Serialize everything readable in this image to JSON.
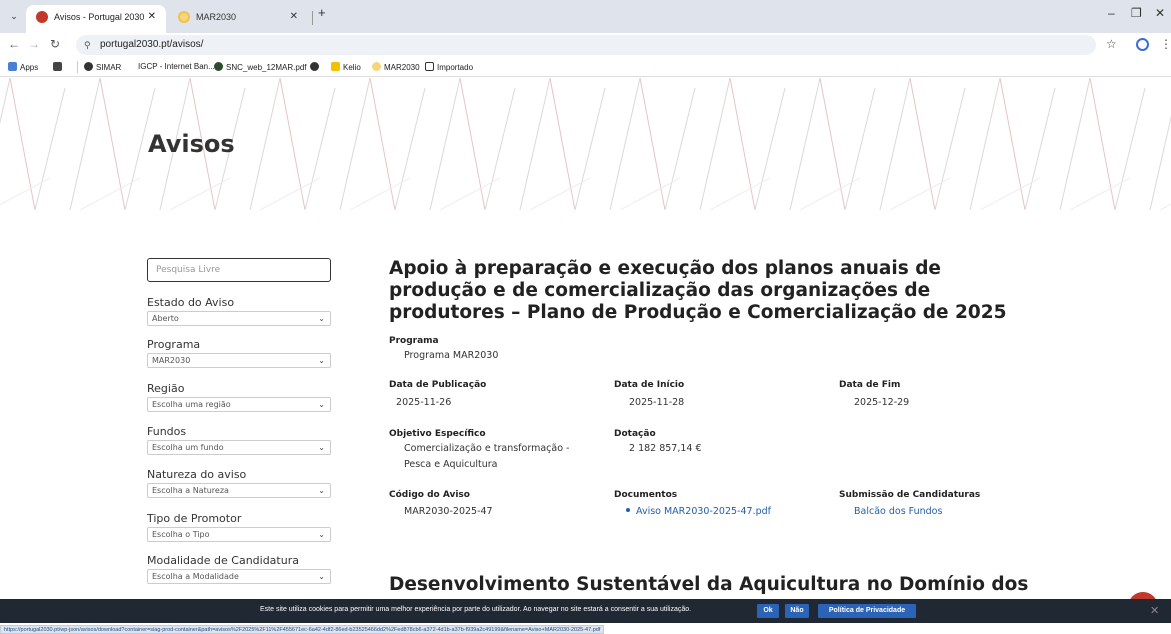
{
  "browser": {
    "tabs": [
      {
        "title": "Avisos - Portugal 2030",
        "active": true
      },
      {
        "title": "MAR2030",
        "active": false
      }
    ],
    "new_tab": "+",
    "url": "portugal2030.pt/avisos/",
    "bookmarks": [
      {
        "label": "Apps"
      },
      {
        "label": "SIMAR"
      },
      {
        "label": "IGCP - Internet Ban..."
      },
      {
        "label": "SNC_web_12MAR.pdf"
      },
      {
        "label": "Kelio"
      },
      {
        "label": "MAR2030"
      },
      {
        "label": "Importado"
      }
    ],
    "status_url": "https://portugal2030.pt/wp-json/avisos/download?container=siag-prod-container&path=avisos%2F2025%2F11%2F455671ec-6a42-4df2-86ed-b23525466dd2%2Fed878cb6-a372-4d1b-a37b-f939a2c49199&filename=Aviso+MAR2030-2025-47.pdf"
  },
  "page": {
    "hero_title": "Avisos"
  },
  "sidebar": {
    "search_placeholder": "Pesquisa Livre",
    "filters": [
      {
        "label": "Estado do Aviso",
        "value": "Aberto"
      },
      {
        "label": "Programa",
        "value": "MAR2030"
      },
      {
        "label": "Região",
        "value": "Escolha uma região"
      },
      {
        "label": "Fundos",
        "value": "Escolha um fundo"
      },
      {
        "label": "Natureza do aviso",
        "value": "Escolha a Natureza"
      },
      {
        "label": "Tipo de Promotor",
        "value": "Escolha o Tipo"
      },
      {
        "label": "Modalidade de Candidatura",
        "value": "Escolha a Modalidade"
      }
    ]
  },
  "aviso": {
    "title": "Apoio à preparação e execução dos planos anuais de produção e de comercialização das organizações de produtores – Plano de Produção e Comercialização de 2025",
    "programa_label": "Programa",
    "programa_value": "Programa MAR2030",
    "data_publicacao_label": "Data de Publicação",
    "data_publicacao_value": "2025-11-26",
    "data_inicio_label": "Data de Início",
    "data_inicio_value": "2025-11-28",
    "data_fim_label": "Data de Fim",
    "data_fim_value": "2025-12-29",
    "objetivo_label": "Objetivo Específico",
    "objetivo_value": "Comercialização e transformação - Pesca e Aquicultura",
    "dotacao_label": "Dotação",
    "dotacao_value": "2 182 857,14 €",
    "codigo_label": "Código do Aviso",
    "codigo_value": "MAR2030-2025-47",
    "documentos_label": "Documentos",
    "documento_link": "Aviso MAR2030-2025-47.pdf",
    "submissao_label": "Submissão de Candidaturas",
    "submissao_link": "Balcão dos Fundos"
  },
  "next_aviso_title": "Desenvolvimento Sustentável da Aquicultura no Domínio dos",
  "cookie": {
    "text": "Este site utiliza cookies para permitir uma melhor experiência por parte do utilizador. Ao navegar no site estará a consentir a sua utilização.",
    "ok": "Ok",
    "nao": "Não",
    "privacy": "Política de Privacidade"
  }
}
